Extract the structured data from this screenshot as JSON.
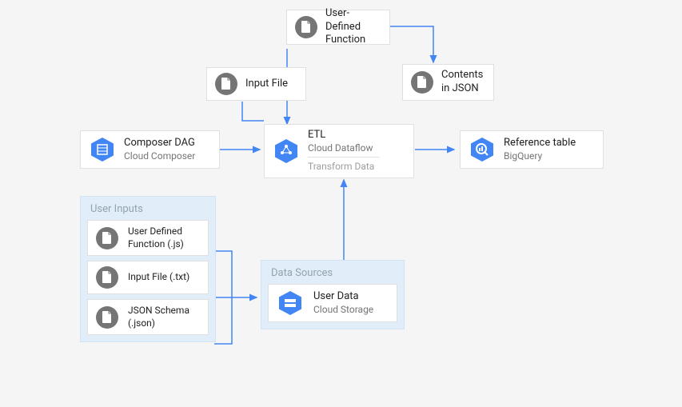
{
  "nodes": {
    "udf_top": {
      "title": "User-Defined Function"
    },
    "input_file": {
      "title": "Input File"
    },
    "contents_json": {
      "title": "Contents in JSON"
    },
    "composer_dag": {
      "title": "Composer DAG",
      "subtitle": "Cloud Composer"
    },
    "etl": {
      "title": "ETL",
      "subtitle": "Cloud Dataflow",
      "action": "Transform Data"
    },
    "reference_table": {
      "title": "Reference table",
      "subtitle": "BigQuery"
    }
  },
  "groups": {
    "user_inputs": {
      "title": "User Inputs",
      "items": [
        {
          "title": "User Defined Function (.js)"
        },
        {
          "title": "Input File (.txt)"
        },
        {
          "title": "JSON Schema (.json)"
        }
      ]
    },
    "data_sources": {
      "title": "Data Sources",
      "items": [
        {
          "title": "User Data",
          "subtitle": "Cloud Storage"
        }
      ]
    }
  }
}
